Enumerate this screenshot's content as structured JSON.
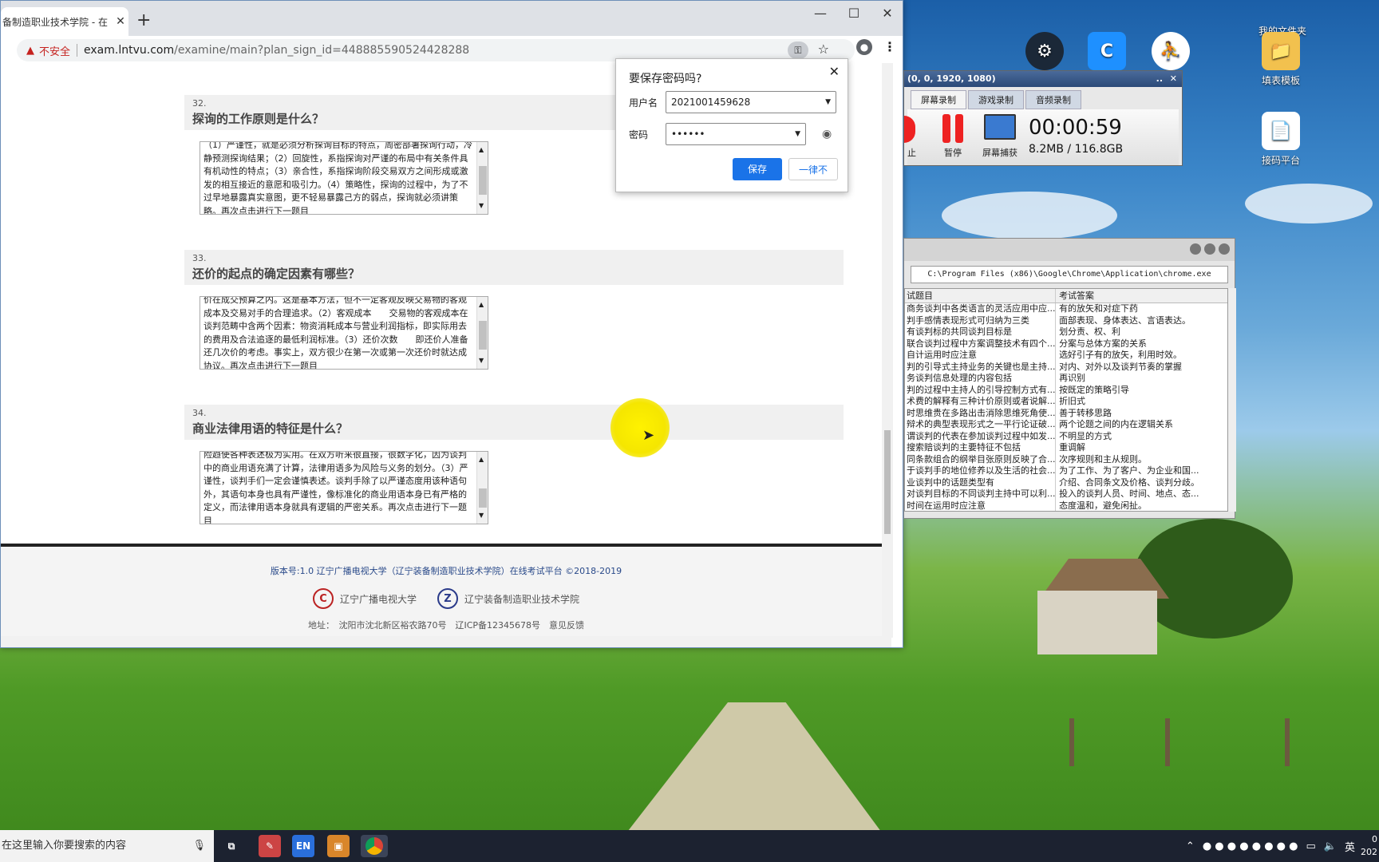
{
  "browser": {
    "tab_title": "备制造职业技术学院 - 在",
    "tab_close": "✕",
    "new_tab": "+",
    "insecure_label": "不安全",
    "url_host": "exam.lntvu.com",
    "url_path": "/examine/main?plan_sign_id=448885590524428288",
    "win_min": "—",
    "win_max": "☐",
    "win_close": "✕"
  },
  "questions": [
    {
      "num": "32.",
      "title": "探询的工作原则是什么？",
      "answer": "（1）严谨性，就是必须分析探询目标的特点，周密部署探询行动，冷静预测探询结果；（2）回旋性，系指探询对严谨的布局中有关条件具有机动性的特点；（3）亲合性，系指探询阶段交易双方之间形成或激发的相互接近的意愿和吸引力。（4）策略性，探询的过程中，为了不过早地暴露真实意图，更不轻易暴露己方的弱点，探询就必须讲策略。再次点击进行下一题目"
    },
    {
      "num": "33.",
      "title": "还价的起点的确定因素有哪些？",
      "answer": "价在成交预算之内。这是基本方法，但不一定客观反映交易物的客观成本及交易对手的合理追求。（2）客观成本　　交易物的客观成本在谈判范畴中含两个因素：物资消耗成本与营业利润指标，即实际用去的费用及合法追逐的最低利润标准。（3）还价次数　　即还价人准备还几次价的考虑。事实上，双方很少在第一次或第一次还价时就达成协议。再次点击进行下一题目"
    },
    {
      "num": "34.",
      "title": "商业法律用语的特征是什么？",
      "answer": "险趋使各种表述极为实用。在双方听来很直接，很数字化，因为谈判中的商业用语充满了计算，法律用语多为风险与义务的划分。（3）严谨性，谈判手们一定会谨慎表述。谈判手除了以严谨态度用该种语句外，其语句本身也具有严谨性，像标准化的商业用语本身已有严格的定义，而法律用语本身就具有逻辑的严密关系。再次点击进行下一题目"
    }
  ],
  "footer": {
    "version": "版本号:1.0 辽宁广播电视大学（辽宁装备制造职业技术学院）在线考试平台 ©2018-2019",
    "logo1": "辽宁广播电视大学",
    "logo2": "辽宁装备制造职业技术学院",
    "address": "地址：　沈阳市沈北新区裕农路70号　辽ICP备12345678号　意见反馈"
  },
  "password_popup": {
    "title": "要保存密码吗?",
    "username_label": "用户名",
    "username_value": "2021001459628",
    "password_label": "密码",
    "password_value": "••••••",
    "save_button": "保存",
    "never_button": "一律不",
    "close": "✕"
  },
  "recorder": {
    "title": "(0, 0, 1920, 1080)",
    "tabs": [
      "屏幕录制",
      "游戏录制",
      "音频录制"
    ],
    "stop_label": "止",
    "pause_label": "暂停",
    "capture_label": "屏幕捕获",
    "timer": "00:00:59",
    "size": "8.2MB / 116.8GB",
    "close": "✕",
    "minimize": ".."
  },
  "tool": {
    "path": "C:\\Program Files (x86)\\Google\\Chrome\\Application\\chrome.exe",
    "col1": "试题目",
    "col2": "考试答案",
    "rows": [
      [
        "商务谈判中各类语言的灵活应用中应...",
        "有的放矢和对症下药"
      ],
      [
        "判手感情表现形式可归纳为三类",
        "面部表现、身体表达、言语表达。"
      ],
      [
        "有谈判标的共同谈判目标是",
        "划分责、权、利"
      ],
      [
        "联合谈判过程中方案调整技术有四个...",
        "分案与总体方案的关系"
      ],
      [
        "自计运用时应注意",
        "选好引子有的放矢，利用时效。"
      ],
      [
        "判的引导式主持业务的关键也是主持...",
        "对内、对外以及谈判节奏的掌握"
      ],
      [
        "务谈判信息处理的内容包括",
        "再识别"
      ],
      [
        "判的过程中主持人的引导控制方式有...",
        "按既定的策略引导"
      ],
      [
        "术费的解释有三种计价原则或者说解...",
        "折旧式"
      ],
      [
        "时思维贵在多路出击消除思维死角使...",
        "善于转移思路"
      ],
      [
        "辩术的典型表现形式之一平行论证破...",
        "两个论题之间的内在逻辑关系"
      ],
      [
        "谓谈判的代表在参加谈判过程中如发...",
        "不明显的方式"
      ],
      [
        "搜索赔谈判的主要特征不包括",
        "重调解"
      ],
      [
        "同条款组合的纲举目张原则反映了合...",
        "次序规则和主从规则。"
      ],
      [
        "于谈判手的地位修养以及生活的社会...",
        "为了工作、为了客户、为企业和国..."
      ],
      [
        "业谈判中的话题类型有",
        "介绍、合同条文及价格、谈判分歧。"
      ],
      [
        "对谈判目标的不同谈判主持中可以利...",
        "投入的谈判人员、时间、地点、态..."
      ],
      [
        "时间在运用时应注意",
        "态度温和，避免闲扯。"
      ]
    ]
  },
  "desktop_icons": [
    {
      "label": "我的文件夹"
    },
    {
      "label": "填表模板"
    },
    {
      "label": "接码平台"
    }
  ],
  "taskbar": {
    "search_placeholder": "在这里输入你要搜索的内容",
    "lang": "英",
    "en_label": "EN",
    "clock_line1": "0",
    "clock_line2": "202"
  }
}
